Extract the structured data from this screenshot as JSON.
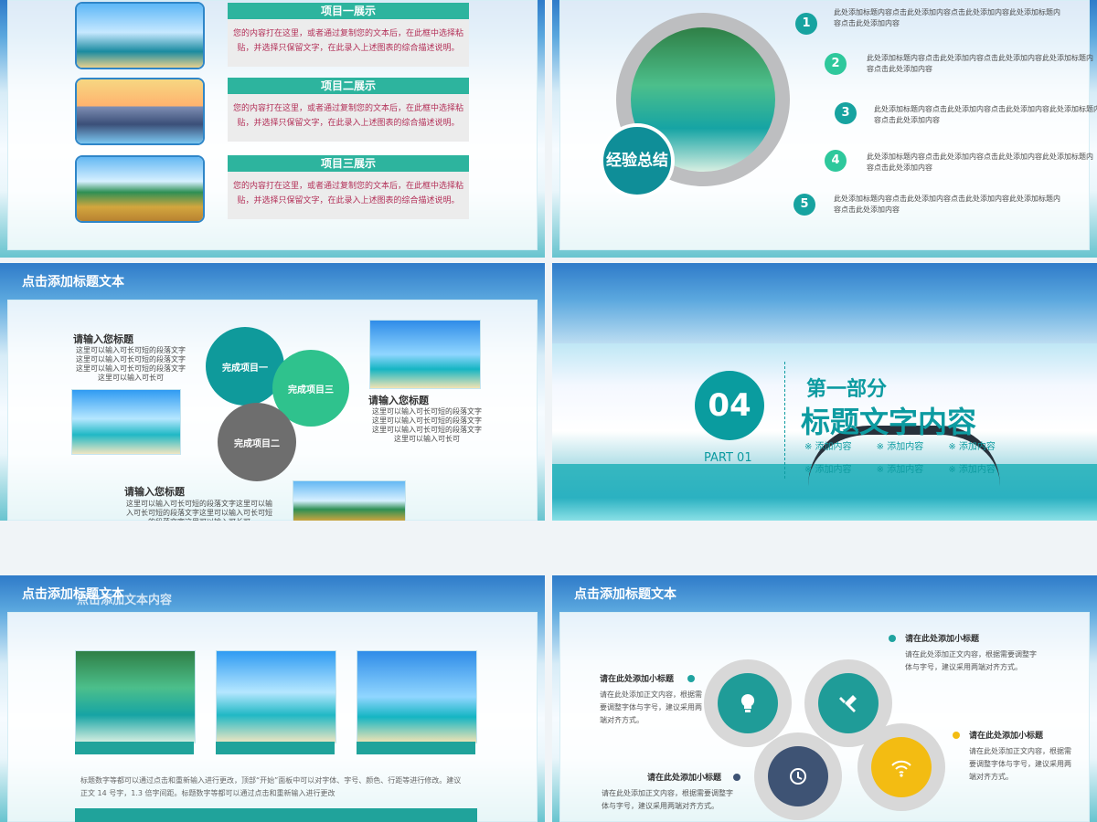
{
  "slide1": {
    "items": [
      {
        "title": "项目一展示",
        "text": "您的内容打在这里，或者通过复制您的文本后，在此框中选择粘贴，并选择只保留文字，在此录入上述图表的综合描述说明。"
      },
      {
        "title": "项目二展示",
        "text": "您的内容打在这里，或者通过复制您的文本后，在此框中选择粘贴，并选择只保留文字，在此录入上述图表的综合描述说明。"
      },
      {
        "title": "项目三展示",
        "text": "您的内容打在这里，或者通过复制您的文本后，在此框中选择粘贴，并选择只保留文字，在此录入上述图表的综合描述说明。"
      }
    ]
  },
  "slide2": {
    "center_label": "经验总结",
    "steps": [
      {
        "num": "1",
        "text": "此处添加标题内容点击此处添加内容点击此处添加内容此处添加标题内容点击此处添加内容"
      },
      {
        "num": "2",
        "text": "此处添加标题内容点击此处添加内容点击此处添加内容此处添加标题内容点击此处添加内容"
      },
      {
        "num": "3",
        "text": "此处添加标题内容点击此处添加内容点击此处添加内容此处添加标题内容点击此处添加内容"
      },
      {
        "num": "4",
        "text": "此处添加标题内容点击此处添加内容点击此处添加内容此处添加标题内容点击此处添加内容"
      },
      {
        "num": "5",
        "text": "此处添加标题内容点击此处添加内容点击此处添加内容此处添加标题内容点击此处添加内容"
      }
    ]
  },
  "slide3": {
    "title": "点击添加标题文本",
    "heading1": "请输入您标题",
    "text1": "这里可以输入可长可短的段落文字这里可以输入可长可短的段落文字这里可以输入可长可短的段落文字这里可以输入可长可",
    "heading2": "请输入您标题",
    "text2": "这里可以输入可长可短的段落文字这里可以输入可长可短的段落文字这里可以输入可长可短的段落文字这里可以输入可长可",
    "heading3": "请输入您标题",
    "text3": "这里可以输入可长可短的段落文字这里可以输入可长可短的段落文字这里可以输入可长可短的段落文字这里可以输入可长可",
    "bubble1": "完成项目一",
    "bubble2": "完成项目三",
    "bubble3": "完成项目二"
  },
  "slide4": {
    "number": "04",
    "part": "第一部分",
    "title": "标题文字内容",
    "code": "PART 01",
    "tags": [
      "添加内容",
      "添加内容",
      "添加内容",
      "添加内容",
      "添加内容",
      "添加内容"
    ]
  },
  "slide5": {
    "title": "点击添加标题文本",
    "overlay": "点击添加文本内容",
    "body": "标题数字等都可以通过点击和重新输入进行更改，顶部“开始”面板中可以对字体、字号、颜色、行距等进行修改。建议正文 14 号字，1.3 倍字间距。标题数字等都可以通过点击和重新输入进行更改"
  },
  "slide6": {
    "title": "点击添加标题文本",
    "labels": [
      {
        "label": "请在此处添加小标题",
        "text": "请在此处添加正文内容，根据需要调整字体与字号，建议采用两端对齐方式。"
      },
      {
        "label": "请在此处添加小标题",
        "text": "请在此处添加正文内容，根据需要调整字体与字号，建议采用两端对齐方式。"
      },
      {
        "label": "请在此处添加小标题",
        "text": "请在此处添加正文内容，根据需要调整字体与字号，建议采用两端对齐方式。"
      },
      {
        "label": "请在此处添加小标题",
        "text": "请在此处添加正文内容，根据需要调整字体与字号，建议采用两端对齐方式。"
      }
    ]
  }
}
